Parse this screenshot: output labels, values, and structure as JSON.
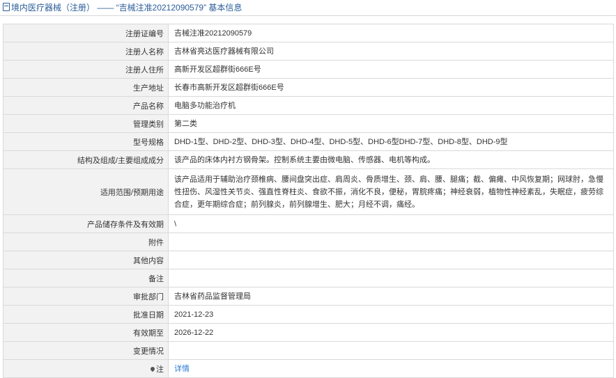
{
  "header": {
    "title": "境内医疗器械（注册） —— “吉械注准20212090579” 基本信息",
    "icon": "document-icon"
  },
  "rows": [
    {
      "label": "注册证编号",
      "value": "吉械注准20212090579"
    },
    {
      "label": "注册人名称",
      "value": "吉林省亮达医疗器械有限公司"
    },
    {
      "label": "注册人住所",
      "value": "高新开发区超群街666E号"
    },
    {
      "label": "生产地址",
      "value": "长春市高新开发区超群街666E号"
    },
    {
      "label": "产品名称",
      "value": "电脑多功能治疗机"
    },
    {
      "label": "管理类别",
      "value": "第二类"
    },
    {
      "label": "型号规格",
      "value": "DHD-1型、DHD-2型、DHD-3型、DHD-4型、DHD-5型、DHD-6型DHD-7型、DHD-8型、DHD-9型"
    },
    {
      "label": "结构及组成/主要组成成分",
      "value": "该产品的床体内衬方钢骨架。控制系统主要由微电脑、传感器、电机等构成。"
    },
    {
      "label": "适用范围/预期用途",
      "value": "该产品适用于辅助治疗颈椎病、腰间盘突出症、肩周炎、骨质增生、颈、肩、腰、腿痛；截、偏瘫、中风恢复期；网球肘，急慢性扭伤、风湿性关节炎、强直性脊柱炎、食欲不振，消化不良，便秘，胃脘疼痛；神经衰弱，植物性神经紊乱，失眠症，疲劳综合症，更年期综合症；前列腺炎，前列腺增生、肥大；月经不调，痛经。"
    },
    {
      "label": "产品储存条件及有效期",
      "value": "\\"
    },
    {
      "label": "附件",
      "value": ""
    },
    {
      "label": "其他内容",
      "value": ""
    },
    {
      "label": "备注",
      "value": ""
    },
    {
      "label": "审批部门",
      "value": "吉林省药品监督管理局"
    },
    {
      "label": "批准日期",
      "value": "2021-12-23"
    },
    {
      "label": "有效期至",
      "value": "2026-12-22"
    },
    {
      "label": "变更情况",
      "value": ""
    }
  ],
  "note_row": {
    "label": "注",
    "link_text": "详情",
    "icon": "pin-icon"
  }
}
